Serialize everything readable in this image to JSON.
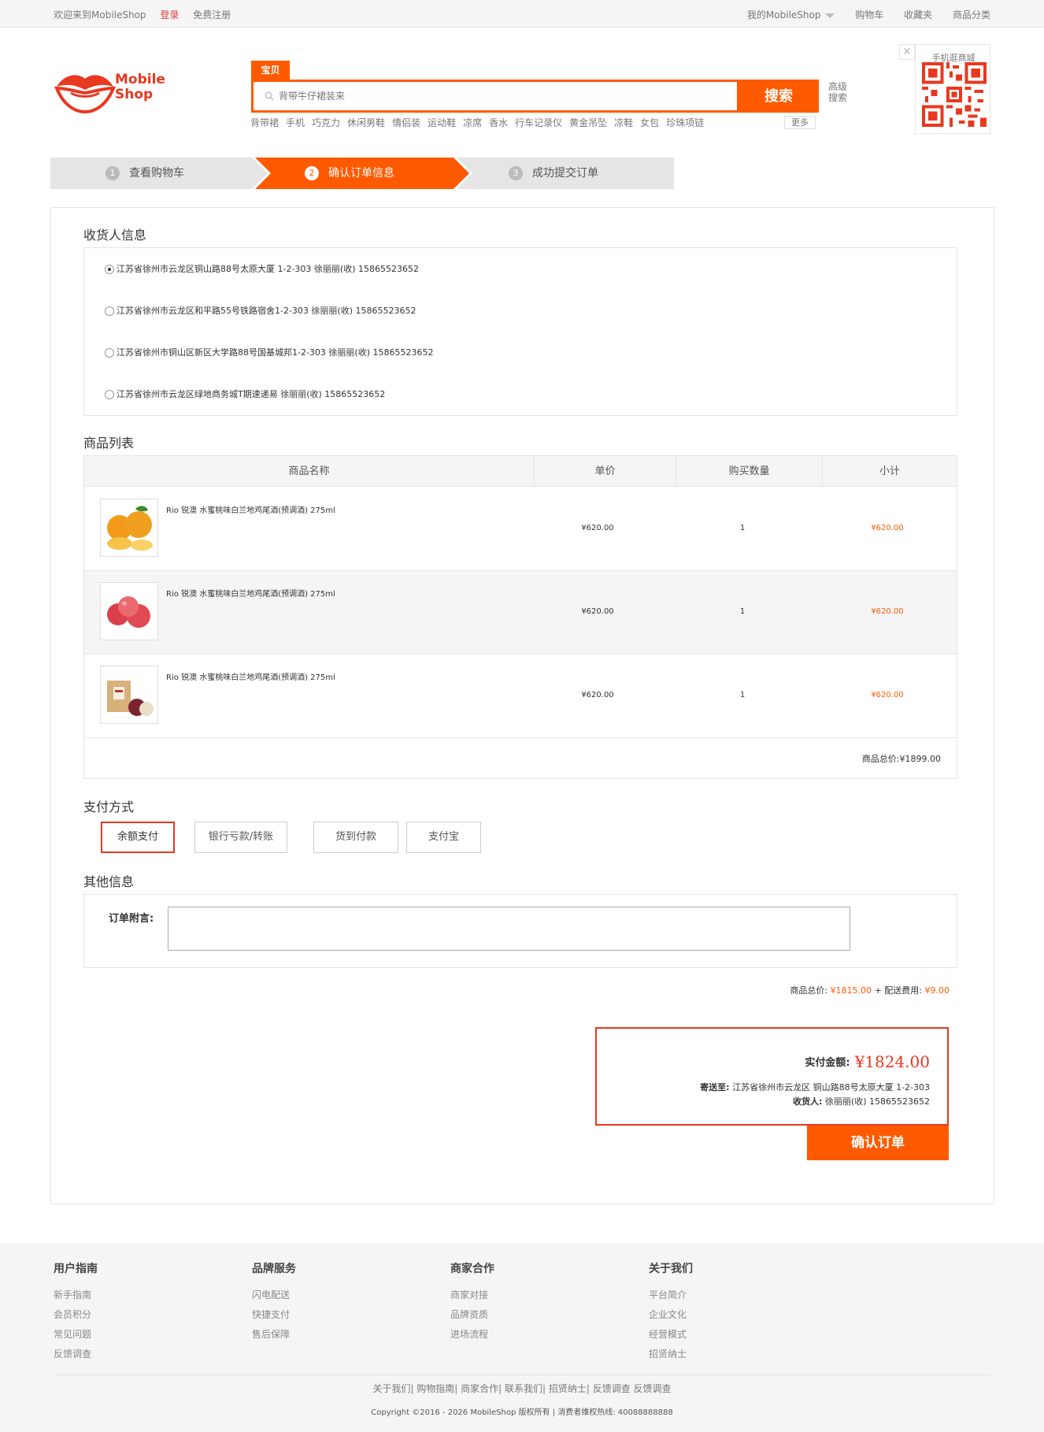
{
  "topbar": {
    "welcome": "欢迎来到MobileShop",
    "login": "登录",
    "register": "免费注册",
    "my_shop": "我的MobileShop",
    "cart": "购物车",
    "favorites": "收藏夹",
    "categories": "商品分类"
  },
  "logo": {
    "line1": "Mobile",
    "line2": "Shop",
    "color": "#e8381f"
  },
  "search": {
    "tab_label": "宝贝",
    "placeholder": "背带牛仔裙装来",
    "button_label": "搜索",
    "advanced": "高级搜索",
    "hotwords": [
      "背带裙",
      "手机",
      "巧克力",
      "休闲男鞋",
      "情侣装",
      "运动鞋",
      "凉席",
      "香水",
      "行车记录仪",
      "黄金吊坠",
      "凉鞋",
      "女包",
      "珍珠项链"
    ],
    "more": "更多"
  },
  "qr": {
    "title": "手机逛商城",
    "close": "×"
  },
  "steps": [
    {
      "num": "1",
      "label": "查看购物车"
    },
    {
      "num": "2",
      "label": "确认订单信息"
    },
    {
      "num": "3",
      "label": "成功提交订单"
    }
  ],
  "address_section": {
    "title": "收货人信息",
    "addresses": [
      {
        "text": "江苏省徐州市云龙区铜山路88号太原大厦 1-2-303 徐丽丽(收) 15865523652",
        "selected": true
      },
      {
        "text": "江苏省徐州市云龙区和平路55号铁路宿舍1-2-303 徐丽丽(收) 15865523652",
        "selected": false
      },
      {
        "text": "江苏省徐州市铜山区新区大学路88号国基城邦1-2-303 徐丽丽(收) 15865523652",
        "selected": false
      },
      {
        "text": "江苏省徐州市云龙区绿地商务城T期速递易 徐丽丽(收) 15865523652",
        "selected": false
      }
    ]
  },
  "product_section": {
    "title": "商品列表",
    "headers": {
      "name": "商品名称",
      "price": "单价",
      "qty": "购买数量",
      "subtotal": "小计"
    },
    "rows": [
      {
        "name": "Rio 锐澳 水蜜桃味白兰地鸡尾酒(预调酒) 275ml",
        "price": "¥620.00",
        "qty": "1",
        "subtotal": "¥620.00",
        "image": "oranges"
      },
      {
        "name": "Rio 锐澳 水蜜桃味白兰地鸡尾酒(预调酒) 275ml",
        "price": "¥620.00",
        "qty": "1",
        "subtotal": "¥620.00",
        "image": "apples"
      },
      {
        "name": "Rio 锐澳 水蜜桃味白兰地鸡尾酒(预调酒) 275ml",
        "price": "¥620.00",
        "qty": "1",
        "subtotal": "¥620.00",
        "image": "gift-box-apples"
      }
    ],
    "total": "商品总价:¥1899.00"
  },
  "payment_section": {
    "title": "支付方式",
    "methods": [
      "余额支付",
      "银行亏款/转账",
      "货到付款",
      "支付宝"
    ],
    "selected_index": 0
  },
  "other_section": {
    "title": "其他信息",
    "note_label": "订单附言:",
    "note_value": ""
  },
  "fees": {
    "goods_label": "商品总价:",
    "goods_value": "¥1815.00",
    "plus": "+",
    "shipping_label": "配送费用:",
    "shipping_value": "¥9.00"
  },
  "summary": {
    "pay_label": "实付金额:",
    "pay_amount": "¥1824.00",
    "ship_to_label": "寄送至:",
    "ship_to_value": "江苏省徐州市云龙区 铜山路88号太原大厦 1-2-303",
    "receiver_label": "收货人:",
    "receiver_value": "徐丽丽(收) 15865523652",
    "confirm_label": "确认订单"
  },
  "footer": {
    "columns": [
      {
        "title": "用户指南",
        "items": [
          "新手指南",
          "会员积分",
          "常见问题",
          "反馈调查"
        ]
      },
      {
        "title": "品牌服务",
        "items": [
          "闪电配送",
          "快捷支付",
          "售后保障"
        ]
      },
      {
        "title": "商家合作",
        "items": [
          "商家对接",
          "品牌资质",
          "进场流程"
        ]
      },
      {
        "title": "关于我们",
        "items": [
          "平台简介",
          "企业文化",
          "经营模式",
          "招贤纳士"
        ]
      }
    ],
    "links": "关于我们| 购物指南| 商家合作| 联系我们| 招贤纳士| 反馈调查 反馈调查",
    "copyright": "Copyright ©2016 - 2026 MobileShop 版权所有 | 消费者维权热线: 40088888888"
  },
  "colors": {
    "accent": "#ff5a00",
    "brand_red": "#e8381f",
    "step_gray": "#e5e5e5"
  }
}
